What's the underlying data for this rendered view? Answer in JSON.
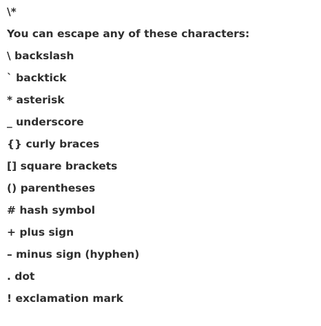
{
  "document": {
    "lines": [
      "\\*",
      "You can escape any of these characters:",
      "\\ backslash",
      "` backtick",
      "* asterisk",
      "_ underscore",
      "{} curly braces",
      "[] square brackets",
      "() parentheses",
      "# hash symbol",
      "+ plus sign",
      "– minus sign (hyphen)",
      ". dot",
      "! exclamation mark"
    ]
  }
}
